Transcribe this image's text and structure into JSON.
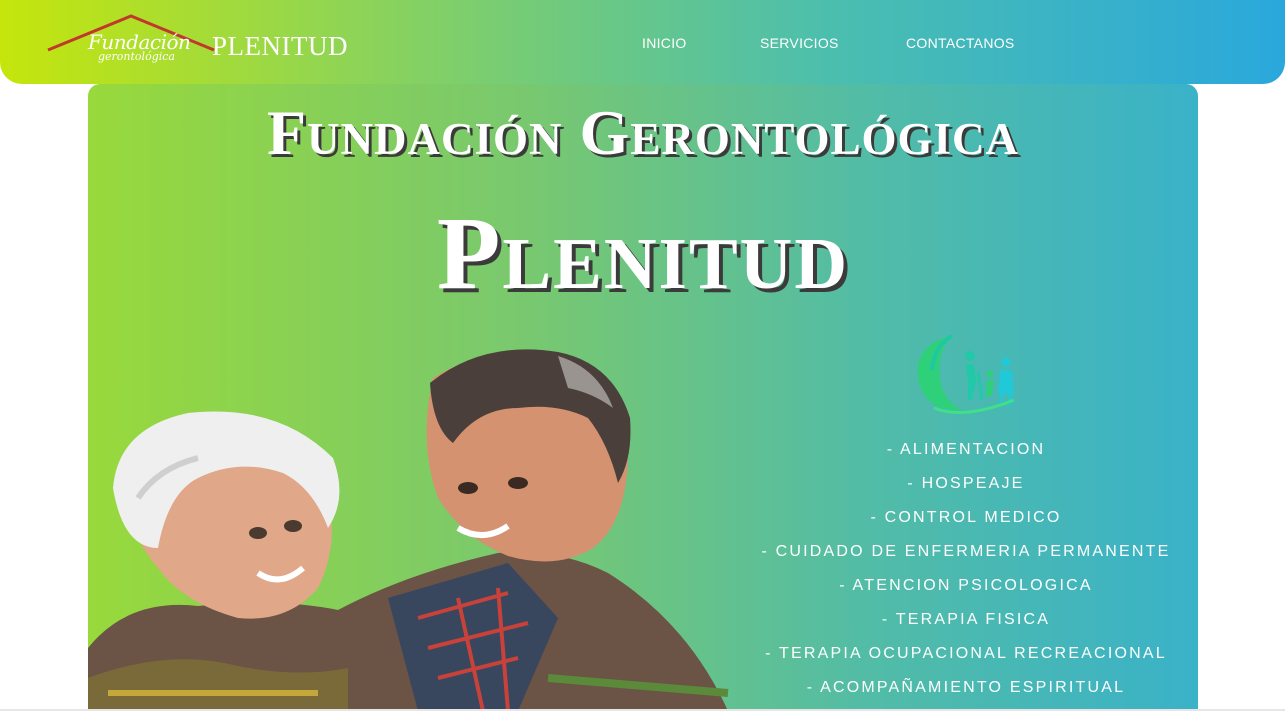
{
  "header": {
    "logo_line1": "Fundación",
    "logo_line2": "gerontológica",
    "brand": "PLENITUD",
    "nav": [
      "INICIO",
      "SERVICIOS",
      "CONTACTANOS"
    ]
  },
  "hero": {
    "title_line1": "Fundación Gerontológica",
    "title_line2": "Plenitud",
    "services": [
      "- ALIMENTACION",
      "- HOSPEAJE",
      "- CONTROL MEDICO",
      "- CUIDADO DE ENFERMERIA PERMANENTE",
      "- ATENCION PSICOLOGICA",
      "- TERAPIA FISICA",
      "- TERAPIA OCUPACIONAL RECREACIONAL",
      "- ACOMPAÑAMIENTO ESPIRITUAL"
    ]
  },
  "icons": [
    "house-roof-logo-icon",
    "elderly-care-logo-icon"
  ],
  "colors": {
    "header_gradient": [
      "#c5e60c",
      "#2aa8dc"
    ],
    "hero_gradient": [
      "#98d93b",
      "#3ab2c8"
    ],
    "roof_red": "#c0392b",
    "text": "#ffffff"
  }
}
